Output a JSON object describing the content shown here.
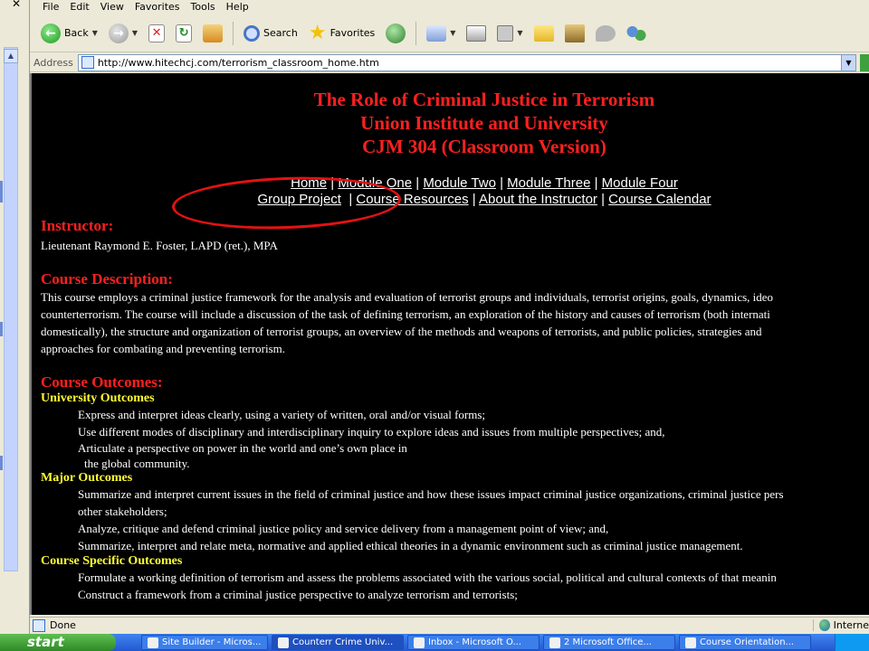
{
  "menu": [
    "File",
    "Edit",
    "View",
    "Favorites",
    "Tools",
    "Help"
  ],
  "toolbar": {
    "back_label": "Back",
    "search_label": "Search",
    "favorites_label": "Favorites"
  },
  "address": {
    "label": "Address",
    "url": "http://www.hitechcj.com/terrorism_classroom_home.htm"
  },
  "page": {
    "title_lines": [
      "The Role of Criminal Justice in Terrorism",
      "Union Institute and University",
      "CJM 304 (Classroom Version)"
    ],
    "nav_row1": [
      "Home",
      "Module One",
      "Module Two",
      "Module Three",
      "Module Four"
    ],
    "nav_row2": [
      "Group Project",
      "Course Resources",
      "About the Instructor",
      "Course Calendar"
    ],
    "instructor_head": "Instructor:",
    "instructor_text": "Lieutenant Raymond E. Foster, LAPD (ret.), MPA",
    "description_head": "Course Description:",
    "description_lines": [
      "This course employs a criminal justice framework for the analysis and evaluation of terrorist groups and individuals, terrorist origins, goals, dynamics, ideo",
      "counterterrorism. The course will include a discussion of the task of defining terrorism, an exploration of the history and causes of terrorism (both internati",
      "domestically), the structure and organization of terrorist groups, an overview of the methods and weapons of terrorists, and public policies, strategies and",
      "approaches for combating and preventing terrorism."
    ],
    "outcomes_head": "Course Outcomes:",
    "university_head": "University Outcomes",
    "university_items": [
      "Express and interpret ideas clearly, using a variety of written, oral and/or visual forms;",
      "Use different modes of disciplinary and interdisciplinary inquiry to explore ideas and issues from multiple perspectives; and,",
      "Articulate a perspective on power in the world and one’s own place in"
    ],
    "university_item_cont": "the global community.",
    "major_head": "Major Outcomes",
    "major_items": [
      "Summarize and interpret current issues in the field of criminal justice and how these issues impact criminal justice organizations, criminal justice pers",
      "other stakeholders;",
      "Analyze, critique and defend criminal justice policy and service delivery from a management point of view; and,",
      "Summarize, interpret and relate meta, normative and applied ethical theories in a dynamic environment such as criminal justice management."
    ],
    "specific_head": "Course Specific Outcomes",
    "specific_items": [
      "Formulate a working definition of terrorism and assess the problems associated with the various social, political and cultural contexts of that meanin",
      "Construct a framework from a criminal justice perspective to analyze terrorism and terrorists;"
    ]
  },
  "status": {
    "text": "Done",
    "zone": "Interne"
  },
  "taskbar": {
    "start_label": "start",
    "tasks": [
      "Site Builder - Micros...",
      "Counterr Crime Univ...",
      "Inbox - Microsoft O...",
      "2 Microsoft Office...",
      "Course Orientation..."
    ]
  },
  "colors": {
    "page_bg": "#000000",
    "title_red": "#ff2020",
    "subhead_yellow": "#ffff33",
    "annotation_red": "#e41212"
  }
}
